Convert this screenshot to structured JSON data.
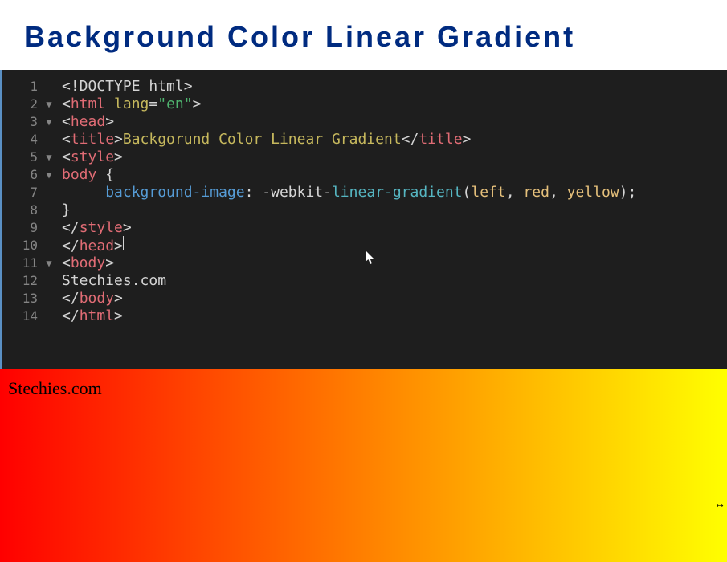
{
  "header": {
    "title": "Background Color Linear Gradient"
  },
  "editor": {
    "lines": [
      {
        "num": "1",
        "fold": "",
        "parts": [
          {
            "t": "<!DOCTYPE html>",
            "c": "c-bracket"
          }
        ]
      },
      {
        "num": "2",
        "fold": "▼",
        "parts": [
          {
            "t": "<",
            "c": "c-bracket"
          },
          {
            "t": "html",
            "c": "c-tag"
          },
          {
            "t": " ",
            "c": "c-text"
          },
          {
            "t": "lang",
            "c": "c-attr"
          },
          {
            "t": "=",
            "c": "c-eq"
          },
          {
            "t": "\"en\"",
            "c": "c-str"
          },
          {
            "t": ">",
            "c": "c-bracket"
          }
        ]
      },
      {
        "num": "3",
        "fold": "▼",
        "parts": [
          {
            "t": "<",
            "c": "c-bracket"
          },
          {
            "t": "head",
            "c": "c-tag"
          },
          {
            "t": ">",
            "c": "c-bracket"
          }
        ]
      },
      {
        "num": "4",
        "fold": "",
        "parts": [
          {
            "t": "<",
            "c": "c-bracket"
          },
          {
            "t": "title",
            "c": "c-tag"
          },
          {
            "t": ">",
            "c": "c-bracket"
          },
          {
            "t": "Backgorund Color Linear Gradient",
            "c": "c-title"
          },
          {
            "t": "</",
            "c": "c-bracket"
          },
          {
            "t": "title",
            "c": "c-close"
          },
          {
            "t": ">",
            "c": "c-bracket"
          }
        ]
      },
      {
        "num": "5",
        "fold": "▼",
        "parts": [
          {
            "t": "<",
            "c": "c-bracket"
          },
          {
            "t": "style",
            "c": "c-tag"
          },
          {
            "t": ">",
            "c": "c-bracket"
          }
        ]
      },
      {
        "num": "6",
        "fold": "▼",
        "parts": [
          {
            "t": "body",
            "c": "c-selector"
          },
          {
            "t": " {",
            "c": "c-punct"
          }
        ]
      },
      {
        "num": "7",
        "fold": "",
        "parts": [
          {
            "t": "     ",
            "c": "c-text"
          },
          {
            "t": "background-image",
            "c": "c-prop"
          },
          {
            "t": ": ",
            "c": "c-punct"
          },
          {
            "t": "-webkit-",
            "c": "c-text"
          },
          {
            "t": "linear-gradient",
            "c": "c-func"
          },
          {
            "t": "(",
            "c": "c-punct"
          },
          {
            "t": "left",
            "c": "c-val"
          },
          {
            "t": ", ",
            "c": "c-punct"
          },
          {
            "t": "red",
            "c": "c-val"
          },
          {
            "t": ", ",
            "c": "c-punct"
          },
          {
            "t": "yellow",
            "c": "c-val"
          },
          {
            "t": ")",
            "c": "c-punct"
          },
          {
            "t": ";",
            "c": "c-punct"
          }
        ]
      },
      {
        "num": "8",
        "fold": "",
        "parts": [
          {
            "t": "}",
            "c": "c-punct"
          }
        ]
      },
      {
        "num": "9",
        "fold": "",
        "parts": [
          {
            "t": "</",
            "c": "c-bracket"
          },
          {
            "t": "style",
            "c": "c-close"
          },
          {
            "t": ">",
            "c": "c-bracket"
          }
        ]
      },
      {
        "num": "10",
        "fold": "",
        "parts": [
          {
            "t": "</",
            "c": "c-bracket"
          },
          {
            "t": "head",
            "c": "c-close"
          },
          {
            "t": ">",
            "c": "c-bracket"
          }
        ],
        "cursor": true
      },
      {
        "num": "11",
        "fold": "▼",
        "parts": [
          {
            "t": "<",
            "c": "c-bracket"
          },
          {
            "t": "body",
            "c": "c-tag"
          },
          {
            "t": ">",
            "c": "c-bracket"
          }
        ]
      },
      {
        "num": "12",
        "fold": "",
        "parts": [
          {
            "t": "Stechies.com",
            "c": "c-text"
          }
        ]
      },
      {
        "num": "13",
        "fold": "",
        "parts": [
          {
            "t": "</",
            "c": "c-bracket"
          },
          {
            "t": "body",
            "c": "c-close"
          },
          {
            "t": ">",
            "c": "c-bracket"
          }
        ]
      },
      {
        "num": "14",
        "fold": "",
        "parts": [
          {
            "t": "</",
            "c": "c-bracket"
          },
          {
            "t": "html",
            "c": "c-close"
          },
          {
            "t": ">",
            "c": "c-bracket"
          }
        ]
      }
    ]
  },
  "preview": {
    "text": "Stechies.com"
  }
}
